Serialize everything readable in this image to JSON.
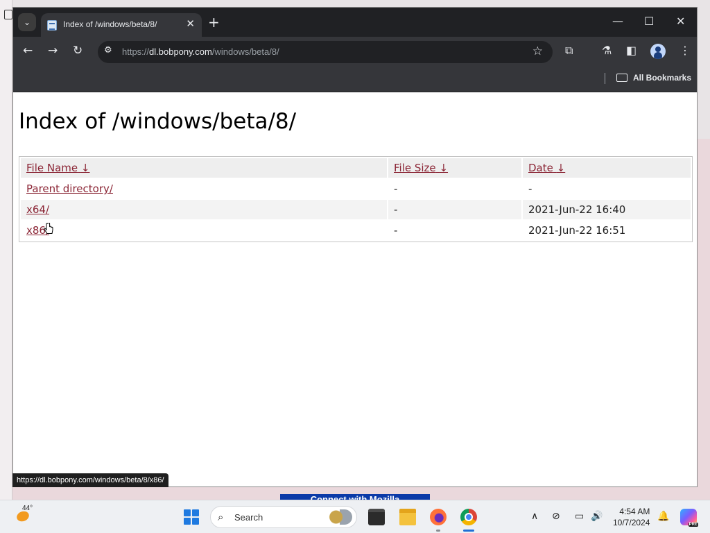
{
  "tab": {
    "title": "Index of /windows/beta/8/",
    "close_glyph": "✕",
    "new_tab_glyph": "+",
    "tab_search_glyph": "⌄"
  },
  "window_controls": {
    "minimize": "—",
    "maximize": "☐",
    "close": "✕"
  },
  "toolbar": {
    "back_glyph": "←",
    "forward_glyph": "→",
    "reload_glyph": "↻",
    "site_info_glyph": "⚙",
    "url_scheme": "https://",
    "url_domain": "dl.bobpony.com",
    "url_path": "/windows/beta/8/",
    "star_glyph": "☆",
    "extensions_glyph": "⧉",
    "labs_glyph": "⚗",
    "sidepanel_glyph": "◧",
    "menu_glyph": "⋮"
  },
  "bookmarks": {
    "all_bookmarks_label": "All Bookmarks"
  },
  "page": {
    "heading": "Index of /windows/beta/8/",
    "columns": [
      {
        "label": "File Name",
        "sort": "↓"
      },
      {
        "label": "File Size",
        "sort": "↓"
      },
      {
        "label": "Date",
        "sort": "↓"
      }
    ],
    "rows": [
      {
        "name": "Parent directory/",
        "size": "-",
        "date": "-"
      },
      {
        "name": "x64/",
        "size": "-",
        "date": "2021-Jun-22 16:40"
      },
      {
        "name": "x86/",
        "size": "-",
        "date": "2021-Jun-22 16:51"
      }
    ]
  },
  "status_bar": {
    "url": "https://dl.bobpony.com/windows/beta/8/x86/"
  },
  "taskbar": {
    "weather_temp": "44°",
    "search_label": "Search",
    "clock_time": "4:54 AM",
    "clock_date": "10/7/2024",
    "copilot_badge": "PRE",
    "tray": {
      "chevron": "∧",
      "network": "⊘",
      "display": "▭",
      "volume": "🔊",
      "bell": "🔔"
    }
  },
  "background": {
    "behind_text": "Connect with Mozilla"
  }
}
